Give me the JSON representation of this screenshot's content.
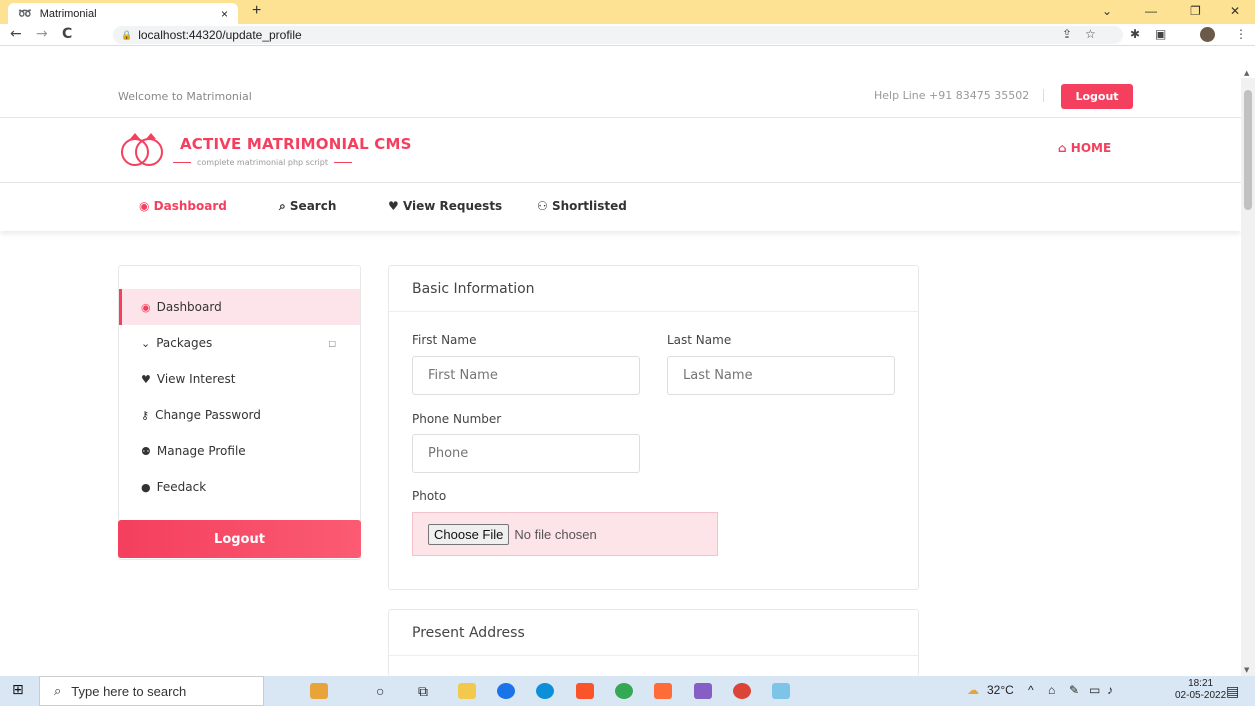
{
  "browser": {
    "tab_title": "Matrimonial",
    "tab_close": "×",
    "new_tab": "+",
    "url": "localhost:44320/update_profile",
    "win_min": "—",
    "win_restore": "❐",
    "win_close": "✕",
    "chevron": "⌄"
  },
  "topbar": {
    "welcome": "Welcome to Matrimonial",
    "helpline": "Help Line +91 83475 35502",
    "logout": "Logout"
  },
  "header": {
    "brand": "ACTIVE MATRIMONIAL CMS",
    "tagline": "complete matrimonial php script",
    "home": "HOME"
  },
  "mainnav": [
    {
      "label": "Dashboard"
    },
    {
      "label": "Search"
    },
    {
      "label": "View Requests"
    },
    {
      "label": "Shortlisted"
    }
  ],
  "sidebar": {
    "items": [
      {
        "label": "Dashboard"
      },
      {
        "label": "Packages"
      },
      {
        "label": "View Interest"
      },
      {
        "label": "Change Password"
      },
      {
        "label": "Manage Profile"
      },
      {
        "label": "Feedack"
      }
    ],
    "logout": "Logout"
  },
  "basic_info": {
    "title": "Basic Information",
    "first_name_label": "First Name",
    "first_name_placeholder": "First Name",
    "last_name_label": "Last Name",
    "last_name_placeholder": "Last Name",
    "phone_label": "Phone Number",
    "phone_placeholder": "Phone",
    "photo_label": "Photo",
    "choose_file": "Choose File",
    "no_file": "No file chosen"
  },
  "present_address": {
    "title": "Present Address"
  },
  "taskbar": {
    "search_placeholder": "Type here to search",
    "weather": "32°C",
    "time": "18:21",
    "date": "02-05-2022"
  }
}
